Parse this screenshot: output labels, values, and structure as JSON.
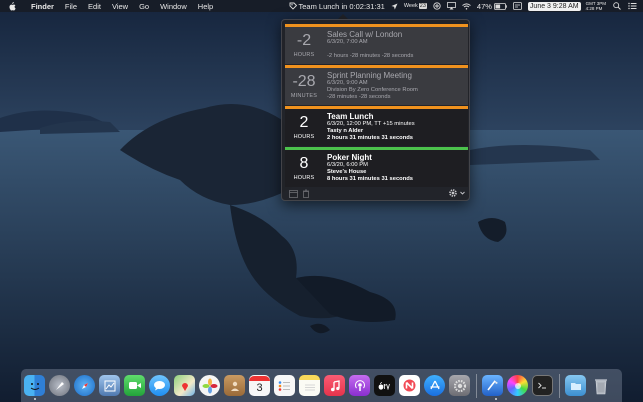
{
  "menubar": {
    "app_name": "Finder",
    "menus": [
      "File",
      "Edit",
      "View",
      "Go",
      "Window",
      "Help"
    ],
    "status_text": "Team Lunch in 0:02:31:31",
    "week_label": "Week",
    "week_number": "23",
    "battery_percent": "47%",
    "date_badge": "June 3  9:28 AM",
    "clock_stack": [
      "GMT 3PM",
      "4:28 PM"
    ]
  },
  "events": [
    {
      "count": "-2",
      "unit": "HOURS",
      "title": "Sales Call w/ London",
      "lines": [
        "6/3/20, 7:00 AM",
        "",
        "-2 hours -28 minutes -28 seconds"
      ],
      "bar_color": "#f0921e",
      "state": "past"
    },
    {
      "count": "-28",
      "unit": "MINUTES",
      "title": "Sprint Planning Meeting",
      "lines": [
        "6/3/20, 9:00 AM",
        "Division By Zero Conference Room",
        "-28 minutes -28 seconds"
      ],
      "bar_color": "#f0921e",
      "state": "past"
    },
    {
      "count": "2",
      "unit": "HOURS",
      "title": "Team Lunch",
      "lines": [
        "6/3/20, 12:00 PM, TT +15 minutes",
        "Tasty n Alder",
        "2 hours 31 minutes 31 seconds"
      ],
      "bar_color": "#f0921e",
      "state": "future"
    },
    {
      "count": "8",
      "unit": "HOURS",
      "title": "Poker Night",
      "lines": [
        "6/3/20, 6:00 PM",
        "Steve's House",
        "8 hours 31 minutes 31 seconds"
      ],
      "bar_color": "#4cc24c",
      "state": "future"
    }
  ],
  "dock": {
    "apps": [
      {
        "icon": "finder-icon",
        "color": "#3b9bea"
      },
      {
        "icon": "launchpad-icon",
        "color": "#8a8f9a"
      },
      {
        "icon": "safari-icon",
        "color": "#2e86de"
      },
      {
        "icon": "preview-icon",
        "color": "#6a8fbf"
      },
      {
        "icon": "facetime-icon",
        "color": "#35b44b"
      },
      {
        "icon": "messages-icon",
        "color": "#3aa7f0"
      },
      {
        "icon": "maps-icon",
        "color": "#6bb86b"
      },
      {
        "icon": "photos-icon",
        "color": "#e9a23b"
      },
      {
        "icon": "contacts-icon",
        "color": "#b08451"
      },
      {
        "icon": "calendar-icon",
        "color": "#f4f4f4"
      },
      {
        "icon": "reminders-icon",
        "color": "#f4f4f4"
      },
      {
        "icon": "notes-icon",
        "color": "#f6dc6a"
      },
      {
        "icon": "music-icon",
        "color": "#f04a5f"
      },
      {
        "icon": "podcasts-icon",
        "color": "#a24bd9"
      },
      {
        "icon": "tv-icon",
        "color": "#111111"
      },
      {
        "icon": "news-icon",
        "color": "#f24a55"
      },
      {
        "icon": "app-store-icon",
        "color": "#2f8ef0"
      },
      {
        "icon": "system-preferences-icon",
        "color": "#8d8d92"
      },
      {
        "icon": "xcode-icon",
        "color": "#3b87d8"
      },
      {
        "icon": "color-picker-icon",
        "color": "#e55"
      },
      {
        "icon": "terminal-icon",
        "color": "#222222"
      },
      {
        "icon": "downloads-folder-icon",
        "color": "#5aa8dc"
      },
      {
        "icon": "trash-icon",
        "color": "#9aa0a8"
      }
    ],
    "calendar_day": "3"
  }
}
